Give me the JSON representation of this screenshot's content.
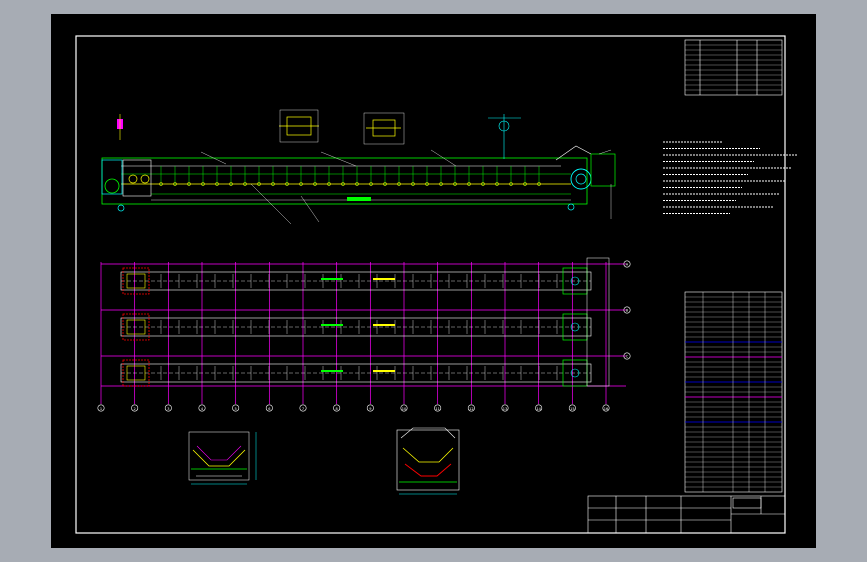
{
  "colors": {
    "background": "#a7acb4",
    "sheet": "#000000",
    "frame": "#ffffff",
    "conveyor": "#00ff00",
    "idler": "#ffff00",
    "grid": "#ff00ff",
    "dimension": "#00ffff",
    "highlight": "#ff0000",
    "tableBlue": "#0000ff"
  },
  "drawing": {
    "grid_columns": [
      "1",
      "2",
      "3",
      "4",
      "5",
      "6",
      "7",
      "8",
      "9",
      "10",
      "11",
      "12",
      "13",
      "14",
      "15",
      "16"
    ],
    "grid_rows": [
      "A",
      "B",
      "C"
    ]
  }
}
